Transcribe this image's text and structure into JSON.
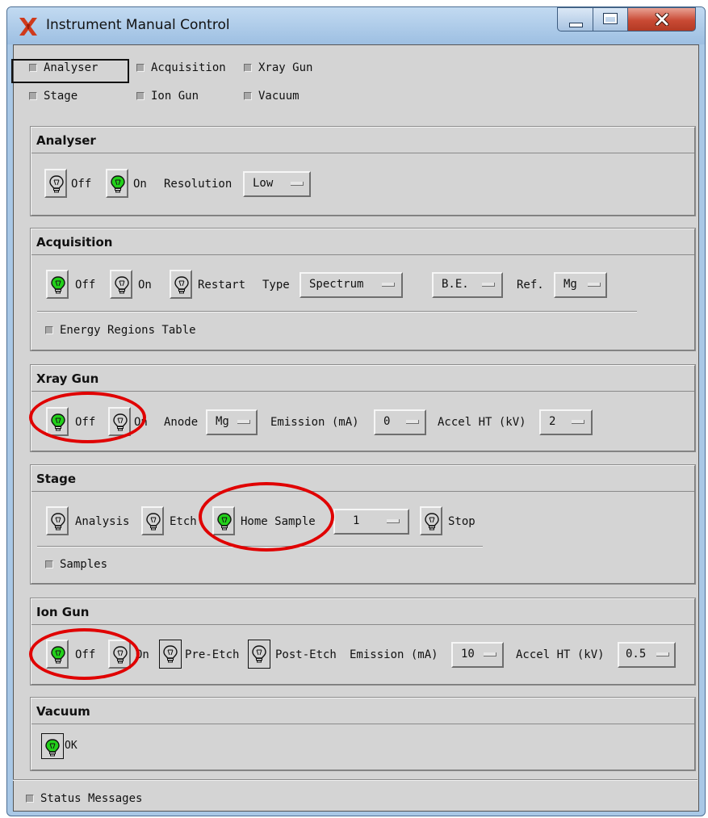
{
  "window": {
    "title": "Instrument Manual Control"
  },
  "toggles": {
    "analyser": "Analyser",
    "acquisition": "Acquisition",
    "xray_gun": "Xray Gun",
    "stage": "Stage",
    "ion_gun": "Ion Gun",
    "vacuum": "Vacuum"
  },
  "analyser": {
    "title": "Analyser",
    "off": "Off",
    "on": "On",
    "resolution_label": "Resolution",
    "resolution_value": "Low",
    "lit": "on"
  },
  "acquisition": {
    "title": "Acquisition",
    "off": "Off",
    "on": "On",
    "restart": "Restart",
    "type_label": "Type",
    "type_value": "Spectrum",
    "scale_value": "B.E.",
    "ref_label": "Ref.",
    "ref_value": "Mg",
    "energy_regions": "Energy Regions Table",
    "lit": "off"
  },
  "xray_gun": {
    "title": "Xray Gun",
    "off": "Off",
    "on": "On",
    "anode_label": "Anode",
    "anode_value": "Mg",
    "emission_label": "Emission (mA)",
    "emission_value": "0",
    "accel_label": "Accel HT (kV)",
    "accel_value": "2",
    "lit": "off"
  },
  "stage": {
    "title": "Stage",
    "analysis": "Analysis",
    "etch": "Etch",
    "home_sample": "Home Sample",
    "sample_value": "1",
    "stop": "Stop",
    "samples": "Samples",
    "lit": "home"
  },
  "ion_gun": {
    "title": "Ion Gun",
    "off": "Off",
    "on": "On",
    "pre_etch": "Pre-Etch",
    "post_etch": "Post-Etch",
    "emission_label": "Emission (mA)",
    "emission_value": "10",
    "accel_label": "Accel HT (kV)",
    "accel_value": "0.5",
    "lit": "off"
  },
  "vacuum": {
    "title": "Vacuum",
    "status": "OK",
    "lit": "ok"
  },
  "status_messages": "Status Messages",
  "colors": {
    "lit_bulb": "#22d01a",
    "highlight_ring": "#e00000",
    "panel_bg": "#d4d4d4"
  }
}
